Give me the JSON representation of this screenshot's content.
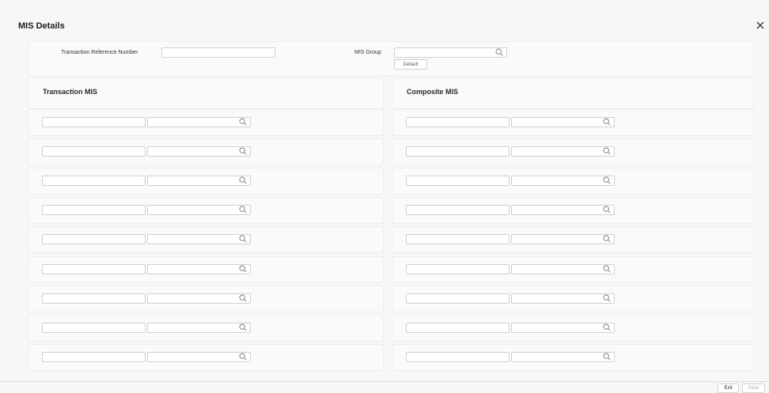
{
  "window": {
    "title": "MIS Details"
  },
  "header": {
    "txn_ref_label": "Transaction Reference Number",
    "txn_ref_required": "*",
    "txn_ref_value": "",
    "mis_group_label": "MIS Group",
    "mis_group_value": "",
    "default_button": "Default"
  },
  "sections": {
    "transaction_title": "Transaction MIS",
    "composite_title": "Composite MIS"
  },
  "footer": {
    "exit_button": "Exit",
    "save_button": "Save"
  },
  "icons": {
    "close": "close-icon",
    "search": "search-icon"
  },
  "colors": {
    "background": "#f7f7f7",
    "panel": "#fafafa",
    "border": "#ececec",
    "required": "#d0021b"
  }
}
